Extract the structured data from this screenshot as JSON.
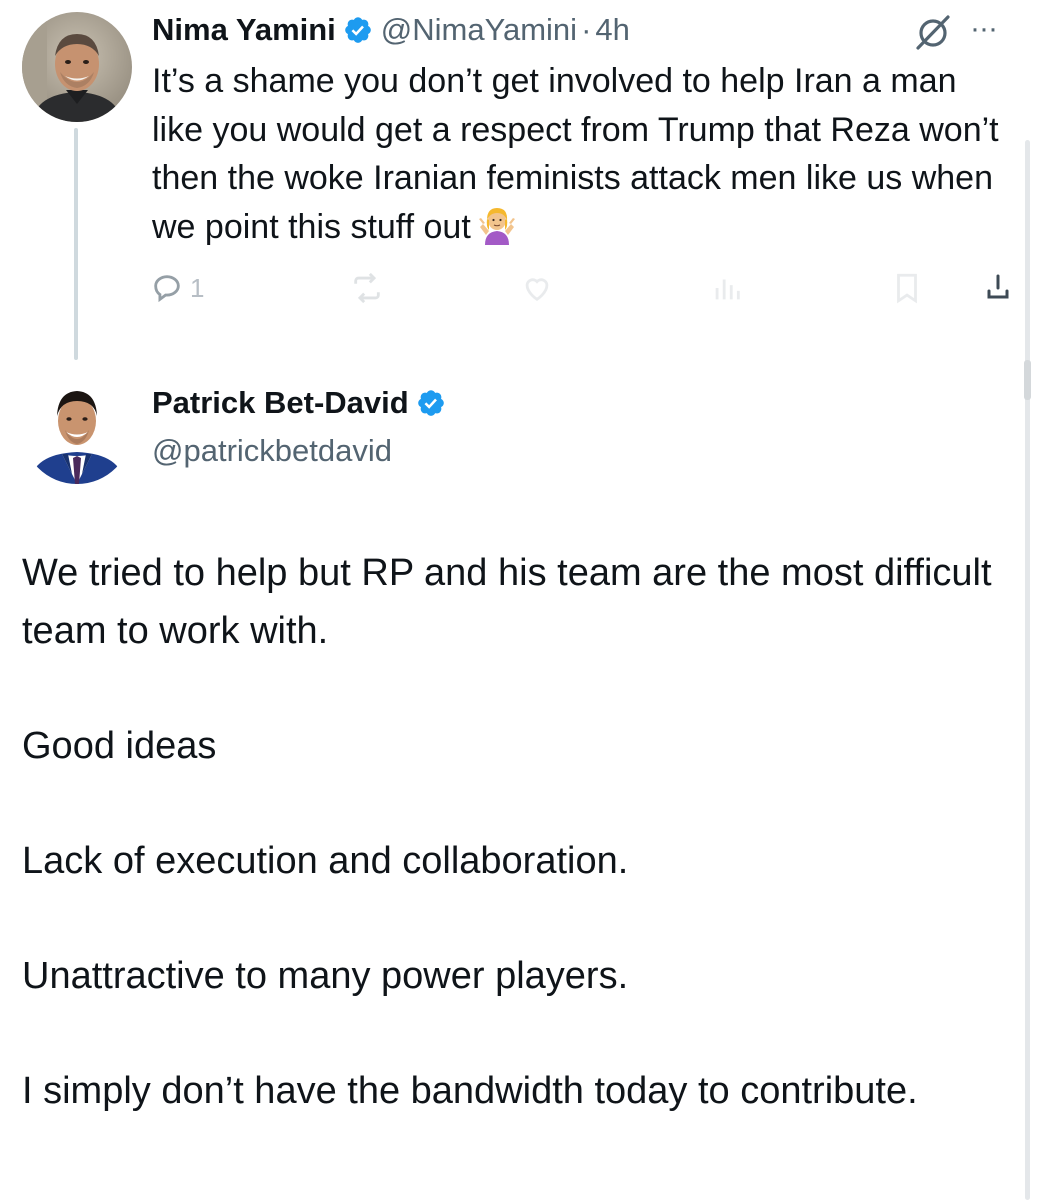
{
  "parent_tweet": {
    "display_name": "Nima Yamini",
    "handle": "@NimaYamini",
    "separator": "·",
    "time": "4h",
    "text": "It’s a shame you don’t get involved to help Iran a man like you would get a respect from Trump that Reza  won’t then the woke Iranian feminists attack men like us when we point this stuff out",
    "emoji": "person-shrugging-emoji",
    "more_icon": "···",
    "reply_count": "1"
  },
  "main_tweet": {
    "display_name": "Patrick Bet-David",
    "handle": "@patrickbetdavid",
    "paragraphs": [
      "We tried to help but RP and his team are the most difficult team to work with.",
      "Good ideas",
      "Lack of execution and collaboration.",
      "Unattractive to many power players.",
      "I simply don’t have the bandwidth today to contribute."
    ]
  },
  "colors": {
    "verified_blue": "#1d9bf0",
    "text_primary": "#0f1419",
    "text_secondary": "#536471",
    "thread_line": "#cfd9de"
  },
  "icons": [
    "verified-badge-icon",
    "grok-icon",
    "more-icon",
    "reply-icon",
    "repost-icon",
    "like-icon",
    "views-icon",
    "bookmark-icon",
    "share-icon"
  ]
}
